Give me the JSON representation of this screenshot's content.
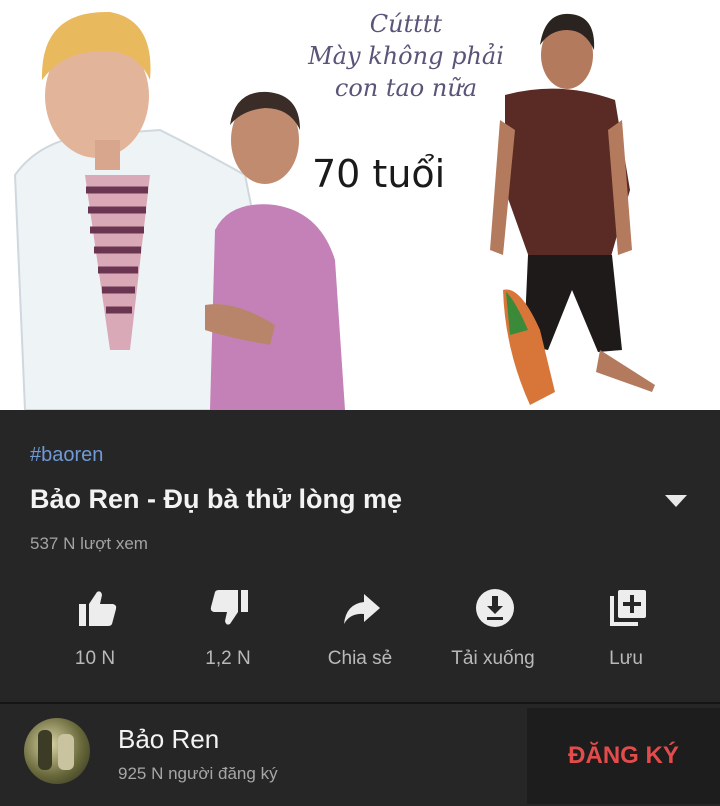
{
  "thumbnail": {
    "caption_lines": [
      "Cútttt",
      "Mày không phải",
      "con tao nữa"
    ],
    "age_text": "70 tuổi"
  },
  "video": {
    "hashtag": "#baoren",
    "title": "Bảo Ren - Đụ bà thử lòng mẹ",
    "views": "537 N lượt xem"
  },
  "actions": {
    "like": "10 N",
    "dislike": "1,2 N",
    "share": "Chia sẻ",
    "download": "Tải xuống",
    "save": "Lưu"
  },
  "channel": {
    "name": "Bảo Ren",
    "subscribers": "925 N người đăng ký",
    "subscribe_label": "ĐĂNG KÝ"
  },
  "colors": {
    "background": "#262626",
    "hashtag": "#6f9ad6",
    "subscribe": "#e44c4c",
    "secondary_text": "#a3a3a3"
  },
  "icons": [
    "thumbs-up-icon",
    "thumbs-down-icon",
    "share-icon",
    "download-icon",
    "playlist-add-icon",
    "chevron-down-icon"
  ]
}
